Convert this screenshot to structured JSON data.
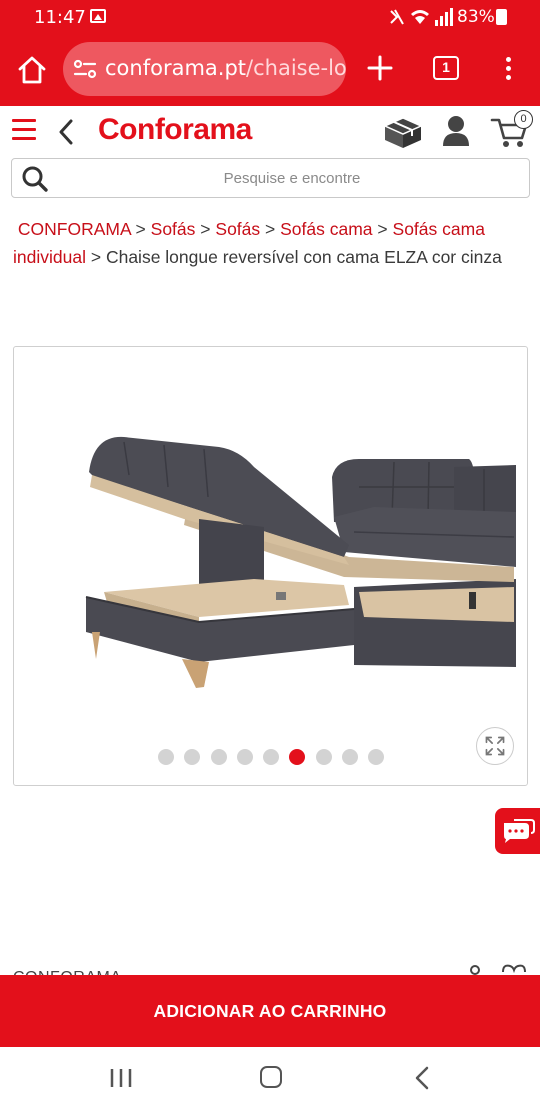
{
  "status_bar": {
    "time": "11:47",
    "battery": "83%"
  },
  "browser": {
    "url_domain": "conforama.pt",
    "url_path": "/chaise-lo",
    "tab_count": "1"
  },
  "header": {
    "brand": "Conforama",
    "cart_count": "0"
  },
  "search": {
    "placeholder": "Pesquise e encontre"
  },
  "breadcrumb": {
    "items": [
      "CONFORAMA",
      "Sofás",
      "Sofás",
      "Sofás cama",
      "Sofás cama individual"
    ],
    "separator": ">",
    "current": "Chaise longue reversível con cama ELZA cor cinza"
  },
  "gallery": {
    "total_images": 9,
    "active_index": 5
  },
  "bottom": {
    "peek_text": "CONFORAMA",
    "add_to_cart_label": "ADICIONAR AO CARRINHO"
  },
  "colors": {
    "brand_red": "#e3101b",
    "link_red": "#c70f19",
    "sofa_fabric": "#4a4a52",
    "wood": "#d9c3a3"
  }
}
